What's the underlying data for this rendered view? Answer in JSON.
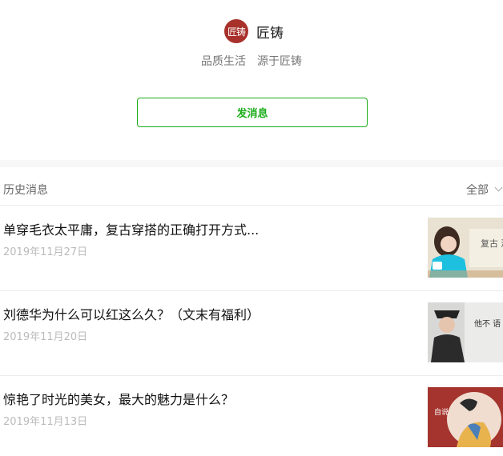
{
  "account": {
    "avatar_text": "匠铸",
    "name": "匠铸",
    "tagline": "品质生活　源于匠铸"
  },
  "actions": {
    "send_message_label": "发消息"
  },
  "history": {
    "title": "历史消息",
    "filter_label": "全部",
    "items": [
      {
        "title": "单穿毛衣太平庸，复古穿搭的正确打开方式...",
        "date": "2019年11月27日",
        "thumb_text": "复古 潮"
      },
      {
        "title": "刘德华为什么可以红这么久？（文末有福利）",
        "date": "2019年11月20日",
        "thumb_text": "他不 语"
      },
      {
        "title": "惊艳了时光的美女，最大的魅力是什么？",
        "date": "2019年11月13日",
        "thumb_text": "自说"
      }
    ]
  },
  "colors": {
    "accent": "#1aad19",
    "avatar_bg": "#a8312b"
  }
}
